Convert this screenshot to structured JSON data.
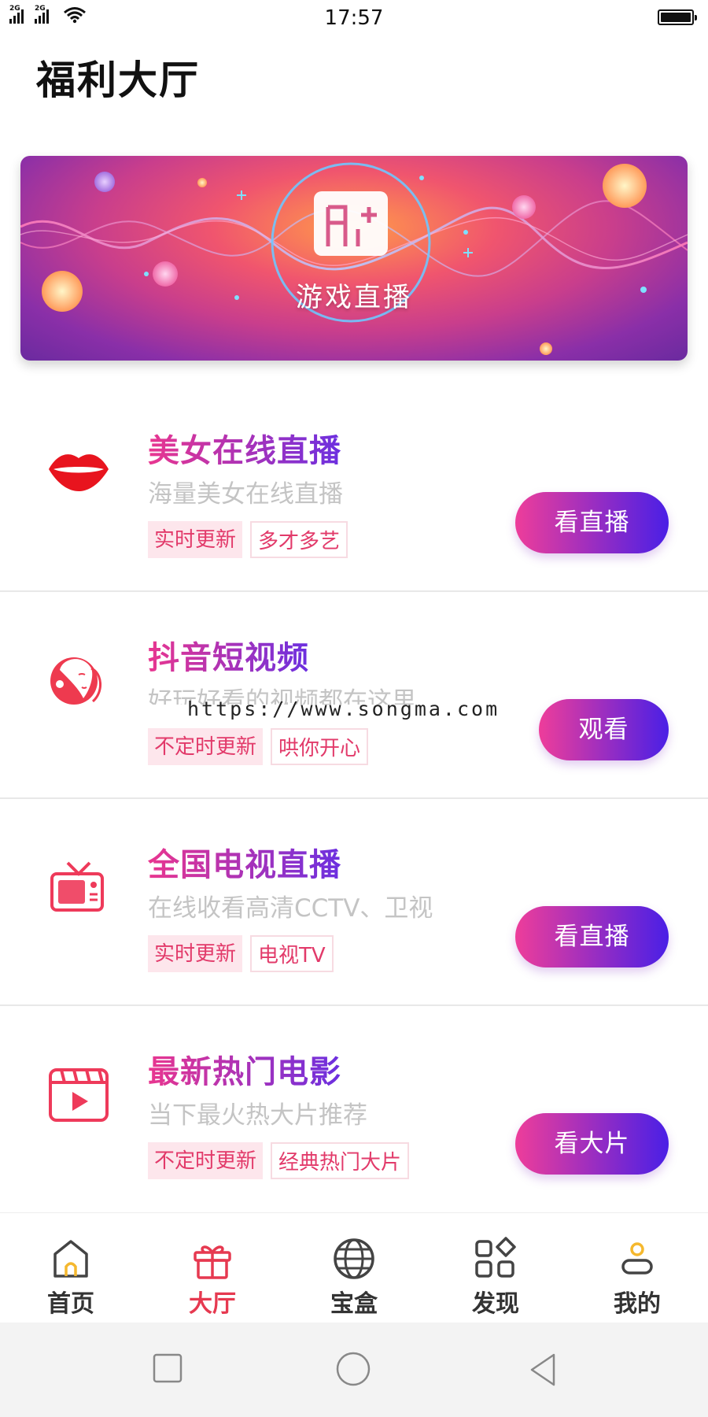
{
  "status_bar": {
    "time": "17:57",
    "network_1": "2G",
    "network_2": "2G"
  },
  "page_title": "福利大厅",
  "banner": {
    "label": "游戏直播",
    "icon": "game-controller-icon"
  },
  "items": [
    {
      "title": "美女在线直播",
      "subtitle": "海量美女在线直播",
      "tags": [
        "实时更新",
        "多才多艺"
      ],
      "button": "看直播",
      "icon": "lips-icon"
    },
    {
      "title": "抖音短视频",
      "subtitle": "好玩好看的视频都在这里",
      "tags": [
        "不定时更新",
        "哄你开心"
      ],
      "button": "观看",
      "icon": "girl-face-icon"
    },
    {
      "title": "全国电视直播",
      "subtitle": "在线收看高清CCTV、卫视",
      "tags": [
        "实时更新",
        "电视TV"
      ],
      "button": "看直播",
      "icon": "tv-icon"
    },
    {
      "title": "最新热门电影",
      "subtitle": "当下最火热大片推荐",
      "tags": [
        "不定时更新",
        "经典热门大片"
      ],
      "button": "看大片",
      "icon": "movie-clapper-icon"
    }
  ],
  "watermark": "https://www.songma.com",
  "bottom_nav": [
    {
      "label": "首页",
      "icon": "home-icon"
    },
    {
      "label": "大厅",
      "icon": "gift-icon"
    },
    {
      "label": "宝盒",
      "icon": "globe-icon"
    },
    {
      "label": "发现",
      "icon": "apps-grid-icon"
    },
    {
      "label": "我的",
      "icon": "user-icon"
    }
  ],
  "colors": {
    "accent_pink": "#e9368f",
    "accent_purple": "#4a1fe6",
    "tag_text": "#e23a6a",
    "nav_active": "#e63950"
  }
}
